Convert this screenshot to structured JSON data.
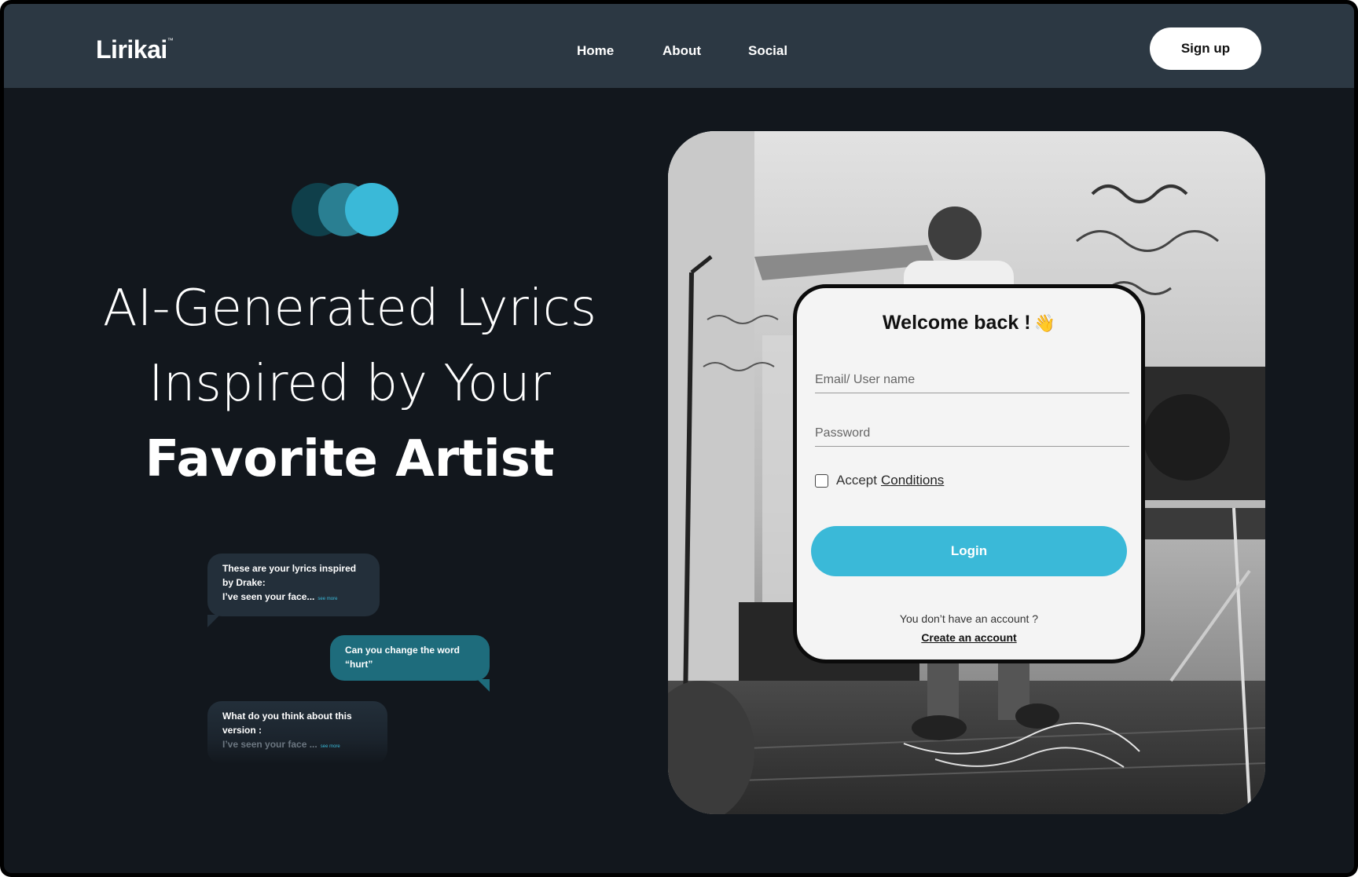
{
  "header": {
    "logo": "Lirikai",
    "logo_mark": "™",
    "nav": [
      "Home",
      "About",
      "Social"
    ],
    "signup_label": "Sign up"
  },
  "hero": {
    "title_line1": "AI-Generated Lyrics",
    "title_line2": "Inspired by Your",
    "title_line3": "Favorite Artist",
    "circle_colors": [
      "#0f3f4a",
      "#2a7f92",
      "#3ab9d8"
    ]
  },
  "chat": {
    "bubble1_line1": "These are your lyrics inspired",
    "bubble1_line2": "by Drake:",
    "bubble1_line3": "I’ve seen your face...",
    "see_more": "see more",
    "bubble2_line1": "Can you change the word",
    "bubble2_line2": "“hurt”",
    "bubble3_line1": "What do you think about this",
    "bubble3_line2": "version :",
    "bubble3_line3": "I’ve seen your face ..."
  },
  "login": {
    "title": "Welcome back !",
    "wave_icon": "👋",
    "email_placeholder": "Email/ User name",
    "password_placeholder": "Password",
    "accept_label": "Accept",
    "conditions_link": "Conditions",
    "login_label": "Login",
    "no_account_text": "You don’t  have an account ?",
    "create_account_link": "Create an account"
  },
  "colors": {
    "accent": "#3ab9d8",
    "header_bg": "#2c3843",
    "page_bg": "#12171d",
    "bubble_dark": "#232f3a",
    "bubble_teal": "#1e6c7c"
  }
}
